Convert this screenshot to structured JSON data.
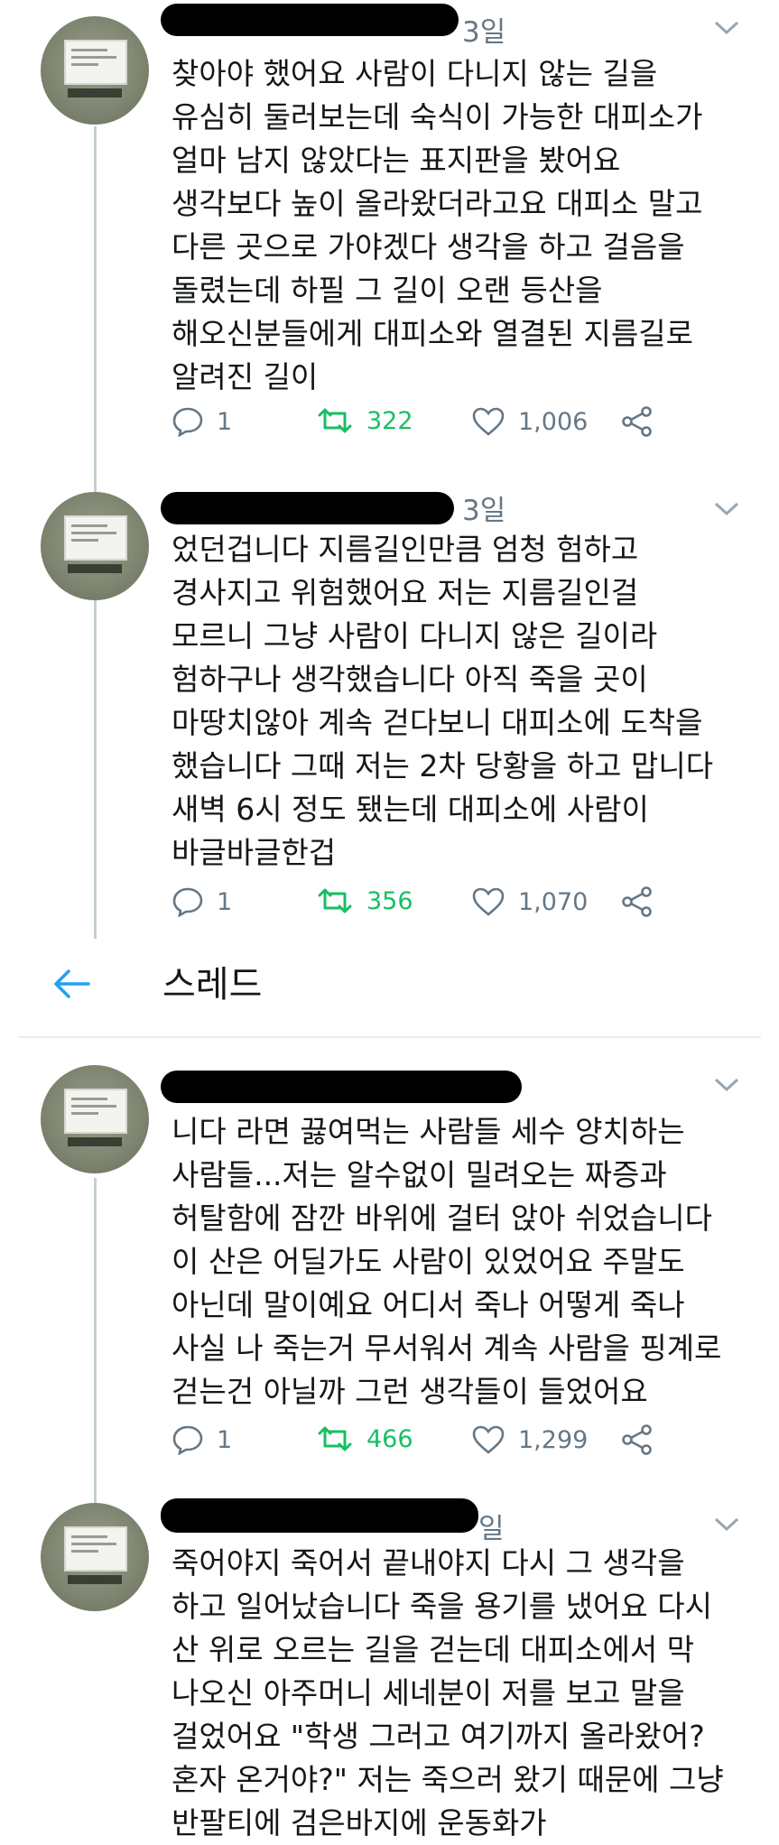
{
  "tweets": [
    {
      "date": "3일",
      "text": "찾아야 했어요 사람이 다니지 않는 길을\n유심히 둘러보는데 숙식이 가능한 대피소가\n얼마 남지 않았다는 표지판을 봤어요\n생각보다 높이 올라왔더라고요 대피소 말고\n다른 곳으로 가야겠다 생각을 하고 걸음을\n돌렸는데 하필 그 길이 오랜 등산을\n해오신분들에게 대피소와 열결된 지름길로\n알려진 길이",
      "replies": "1",
      "retweets": "322",
      "likes": "1,006"
    },
    {
      "date": "3일",
      "text": "었던겁니다 지름길인만큼 엄청 험하고\n경사지고 위험했어요 저는 지름길인걸\n모르니 그냥 사람이 다니지 않은 길이라\n험하구나 생각했습니다 아직 죽을 곳이\n마땅치않아 계속 걷다보니 대피소에 도착을\n했습니다 그때 저는 2차 당황을 하고 맙니다\n새벽 6시 정도 됐는데 대피소에 사람이\n바글바글한겁",
      "replies": "1",
      "retweets": "356",
      "likes": "1,070"
    },
    {
      "date": "",
      "text": "니다 라면 끓여먹는 사람들 세수 양치하는\n사람들...저는 알수없이 밀려오는 짜증과\n허탈함에 잠깐 바위에 걸터 앉아 쉬었습니다\n이 산은 어딜가도 사람이 있었어요 주말도\n아닌데 말이예요 어디서 죽나 어떻게 죽나\n사실 나 죽는거 무서워서 계속 사람을 핑계로\n걷는건 아닐까 그런 생각들이 들었어요",
      "replies": "1",
      "retweets": "466",
      "likes": "1,299"
    },
    {
      "date": "일",
      "text": "죽어야지 죽어서 끝내야지 다시 그 생각을\n하고 일어났습니다 죽을 용기를 냈어요 다시\n산 위로 오르는 길을 걷는데 대피소에서 막\n나오신 아주머니 세네분이 저를 보고 말을\n걸었어요 \"학생 그러고 여기까지 올라왔어?\n혼자 온거야?\" 저는 죽으러 왔기 때문에 그냥\n반팔티에 검은바지에 운동화가",
      "replies": "",
      "retweets": "",
      "likes": ""
    }
  ],
  "thread_header": {
    "title": "스레드"
  },
  "icons": {
    "reply": "reply-icon",
    "retweet": "retweet-icon",
    "like": "heart-icon",
    "share": "share-icon",
    "back": "back-arrow-icon",
    "menu": "chevron-down-icon"
  },
  "colors": {
    "text": "#14171a",
    "secondary": "#657786",
    "retweet": "#17bf63",
    "accent": "#1da1f2"
  }
}
